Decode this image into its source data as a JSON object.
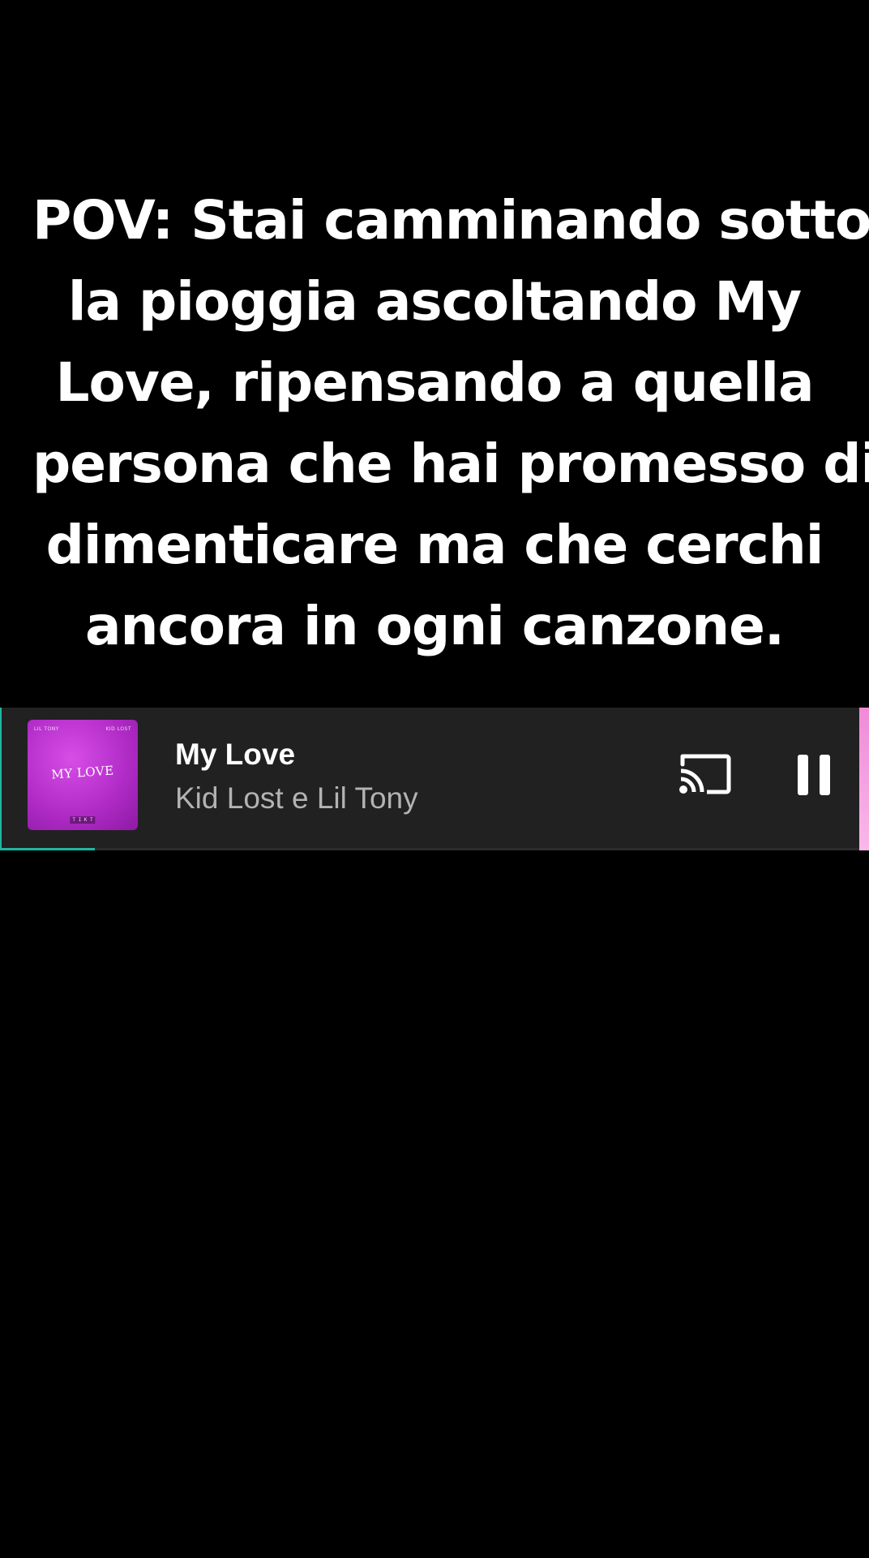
{
  "caption": {
    "lines": [
      "POV: Stai camminando sotto",
      "la pioggia ascoltando My",
      "Love, ripensando a quella",
      "persona che hai promesso di",
      "dimenticare ma che cerchi",
      "ancora in ogni canzone."
    ]
  },
  "player": {
    "cover": {
      "icon": "album-art",
      "top_left_text": "LIL TONY",
      "top_right_text": "KID LOST",
      "title_text": "MY LOVE",
      "badge_text": "T I K T"
    },
    "track_title": "My Love",
    "artist": "Kid Lost e Lil Tony",
    "cast_icon": "cast-icon",
    "pause_icon": "pause-icon",
    "progress": 0.11,
    "colors": {
      "background": "#212121",
      "accent": "#1fb7a0",
      "title": "#ffffff",
      "artist": "#b3b3b3"
    }
  }
}
